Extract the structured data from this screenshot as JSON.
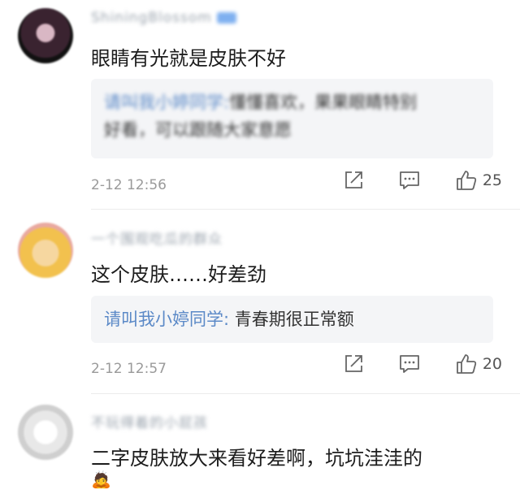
{
  "comments": [
    {
      "user": "ShiningBlossom",
      "text": "眼睛有光就是皮肤不好",
      "reply_user": "请叫我小婷同学:",
      "reply_text_1": "懂懂喜欢，果果眼睛特别",
      "reply_text_2": "好看，可以跟随大家意愿",
      "time": "2-12 12:56",
      "likes": "25"
    },
    {
      "user": "一个围观吃瓜的群众",
      "text": "这个皮肤……好差劲",
      "reply_user": "请叫我小婷同学:",
      "reply_text": "青春期很正常额",
      "time": "2-12 12:57",
      "likes": "20"
    },
    {
      "user": "不玩得着的小屁孩",
      "text": "二字皮肤放大来看好差啊，坑坑洼洼的",
      "emoji": "🙇"
    }
  ],
  "icons": {
    "share": "share-icon",
    "comment": "comment-icon",
    "like": "thumbs-up-icon"
  },
  "colors": {
    "reply_name": "#5b89c7",
    "quote_bg": "#f4f5f7",
    "meta": "#9a9a9a"
  }
}
